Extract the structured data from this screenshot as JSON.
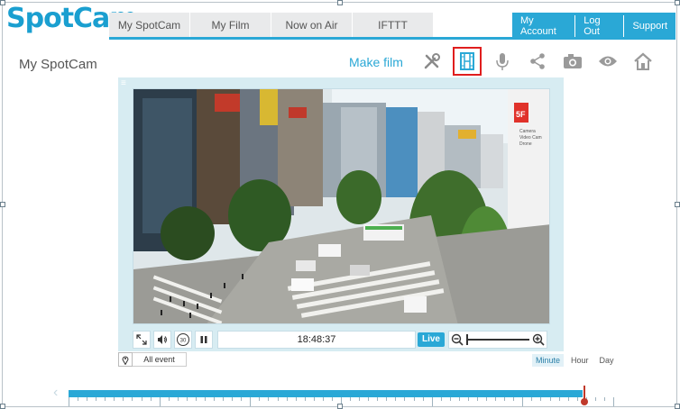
{
  "brand": {
    "logo_text": "SpotCam",
    "logo_color": "#1a9fd0",
    "accent": "#2aa8d6"
  },
  "nav": {
    "tabs": [
      {
        "label": "My SpotCam"
      },
      {
        "label": "My Film"
      },
      {
        "label": "Now on Air"
      },
      {
        "label": "IFTTT"
      }
    ]
  },
  "account": {
    "my_account": "My Account",
    "log_out": "Log Out",
    "support": "Support"
  },
  "page": {
    "title": "My SpotCam",
    "make_film": "Make film"
  },
  "toolbar": {
    "icons": [
      "tools-icon",
      "film-icon",
      "microphone-icon",
      "share-icon",
      "camera-icon",
      "eye-icon",
      "home-icon"
    ],
    "active_icon": "film-icon",
    "active_border": "#e01e1e"
  },
  "video": {
    "overlay_sign": [
      "5F",
      "Camera",
      "Video Cam",
      "Drone"
    ]
  },
  "controls": {
    "time": "18:48:37",
    "live_label": "Live",
    "rewind_seconds": "30",
    "icons": [
      "fullscreen-icon",
      "volume-icon",
      "rewind-30-icon",
      "pause-icon",
      "zoom-out-icon",
      "zoom-in-icon"
    ]
  },
  "events": {
    "filter_label": "All event"
  },
  "scale": {
    "options": [
      "Minute",
      "Hour",
      "Day"
    ],
    "selected": "Minute"
  }
}
